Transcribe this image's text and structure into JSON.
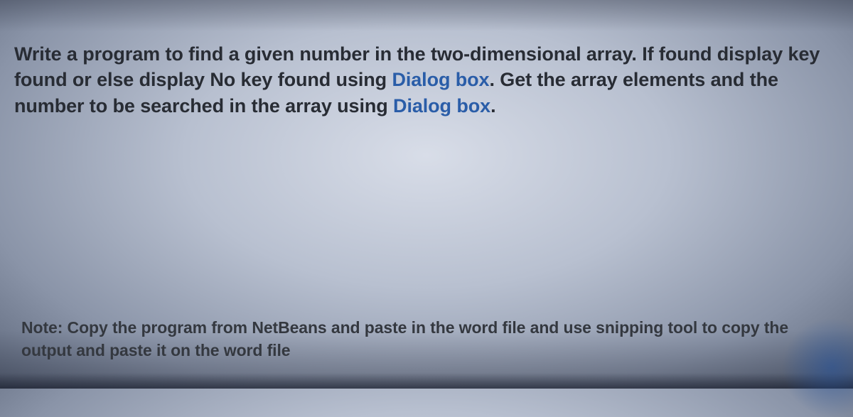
{
  "question": {
    "seg1": "Write a program to find a given number  in the two-dimensional  array. If found display key found or else  display No key found using ",
    "link1": "Dialog box",
    "seg2": ". Get the array elements and the number to be searched in the array using ",
    "link2": "Dialog box",
    "seg3": "."
  },
  "note": "Note: Copy the program from NetBeans and paste in the word file and use snipping tool to copy the output and paste it on the word file"
}
